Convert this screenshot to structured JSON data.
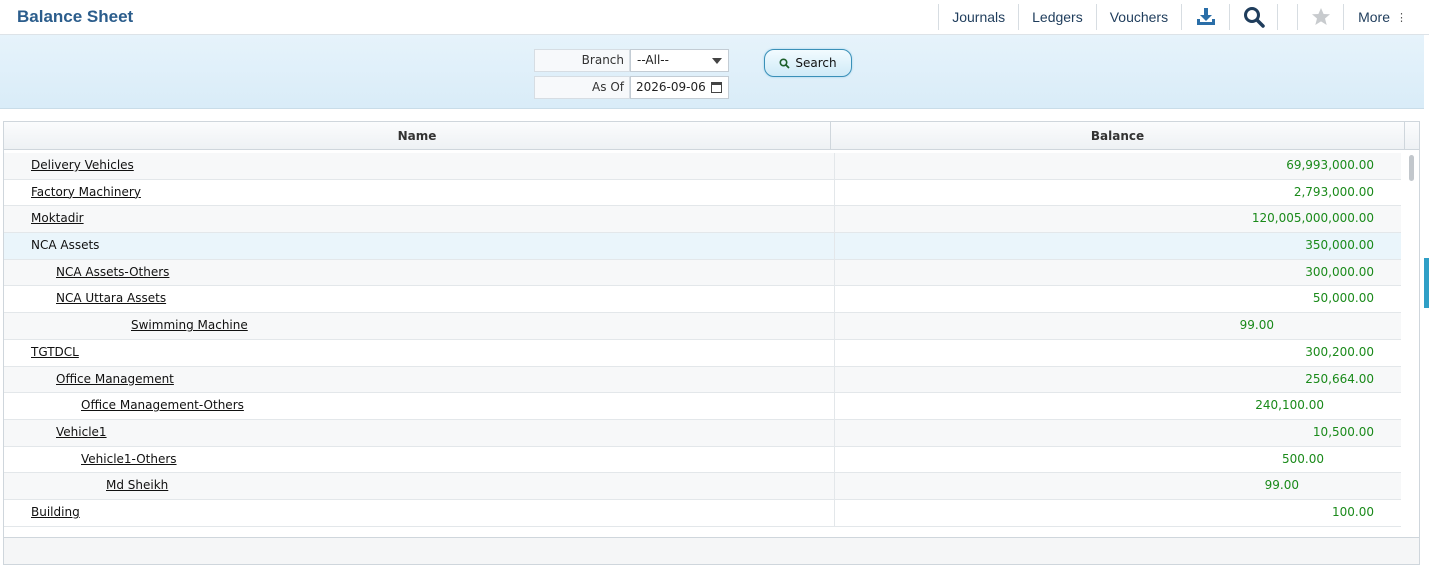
{
  "header": {
    "title": "Balance Sheet",
    "nav": {
      "journals": "Journals",
      "ledgers": "Ledgers",
      "vouchers": "Vouchers",
      "more": "More",
      "more_icon": "kebab-vertical-icon",
      "download_icon": "download-icon",
      "search_icon": "search-icon",
      "favorite_icon": "star-icon"
    }
  },
  "filters": {
    "branch_label": "Branch",
    "branch_value": "--All--",
    "asof_label": "As Of",
    "asof_value": "2026-09-06",
    "search_button": "Search"
  },
  "grid": {
    "columns": [
      "Name",
      "Balance"
    ],
    "rows": [
      {
        "name": "Delivery Vehicles",
        "balance": "69,993,000.00",
        "level": 0,
        "link": true
      },
      {
        "name": "Factory Machinery",
        "balance": "2,793,000.00",
        "level": 0,
        "link": true
      },
      {
        "name": "Moktadir",
        "balance": "120,005,000,000.00",
        "level": 0,
        "link": true
      },
      {
        "name": "NCA Assets",
        "balance": "350,000.00",
        "level": 0,
        "link": false,
        "selected": true
      },
      {
        "name": "NCA Assets-Others",
        "balance": "300,000.00",
        "level": 1,
        "link": true
      },
      {
        "name": "NCA Uttara Assets",
        "balance": "50,000.00",
        "level": 1,
        "link": true
      },
      {
        "name": "Swimming Machine",
        "balance": "99.00",
        "level": 4,
        "link": true
      },
      {
        "name": "TGTDCL",
        "balance": "300,200.00",
        "level": 0,
        "link": true
      },
      {
        "name": "Office Management",
        "balance": "250,664.00",
        "level": 1,
        "link": true
      },
      {
        "name": "Office Management-Others",
        "balance": "240,100.00",
        "level": 2,
        "link": true
      },
      {
        "name": "Vehicle1",
        "balance": "10,500.00",
        "level": 1,
        "link": true
      },
      {
        "name": "Vehicle1-Others",
        "balance": "500.00",
        "level": 2,
        "link": true
      },
      {
        "name": "Md Sheikh",
        "balance": "99.00",
        "level": 3,
        "link": true
      },
      {
        "name": "Building",
        "balance": "100.00",
        "level": 0,
        "link": true
      }
    ]
  },
  "colors": {
    "title": "#2b5d8c",
    "balance_text": "#1a8a1a",
    "accent": "#2f9fc6"
  }
}
